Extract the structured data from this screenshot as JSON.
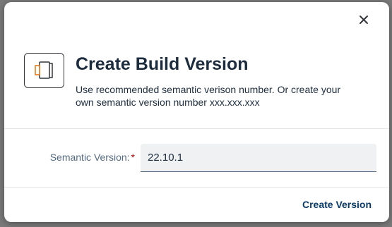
{
  "dialog": {
    "title": "Create Build Version",
    "subtitle": "Use recommended semantic verison number. Or create your own semantic version number xxx.xxx.xxx",
    "header_icon": "copy-icon",
    "close_icon": "close-icon"
  },
  "form": {
    "field_label": "Semantic Version:",
    "required_marker": "*",
    "field_value": "22.10.1"
  },
  "footer": {
    "create_label": "Create Version"
  },
  "colors": {
    "title": "#1d2d3e",
    "label": "#556b82",
    "required": "#aa0808",
    "button_text": "#0a3b66",
    "input_bg": "#eff1f2",
    "icon_accent": "#e9730c"
  }
}
